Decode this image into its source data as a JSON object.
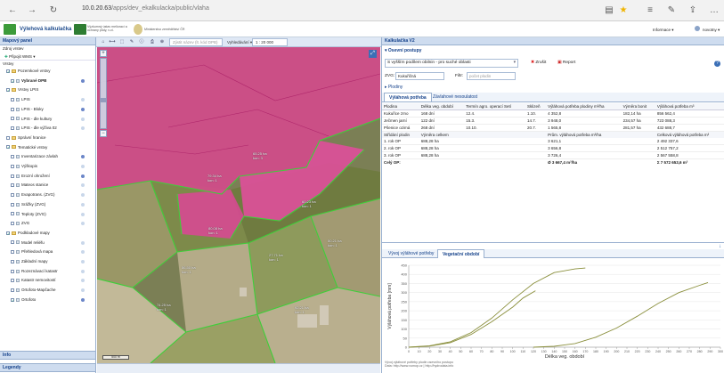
{
  "browser": {
    "url_host": "10.0.20.63",
    "url_path": "/apps/dev_ekalkulacka/public/vlaha"
  },
  "header": {
    "app_name": "Výlehová kalkulačka",
    "partner1": "Výzkumný ústav meliorací a ochrany půdy, v.v.i.",
    "partner2": "Ministerstvo zemědělství ČR",
    "menu_info": "Informace ▾",
    "menu_user": "novotny ▾"
  },
  "toolbar": {
    "search_placeholder": "Zjistit název (lt. kód DPB)",
    "search_btn": "Vyhledávání ▾",
    "scale": "1 : 20 000"
  },
  "left": {
    "title": "Mapový panel",
    "basemap_label": "Zdroj vrstev",
    "add_wms": "Připojit WMS ▾",
    "layers_root": "Vrstvy",
    "layers": [
      {
        "label": "Pozemkové vrstvy",
        "indent": 1,
        "type": "folder",
        "checked": true,
        "dot": ""
      },
      {
        "label": "Vybrané DPB",
        "indent": 2,
        "type": "layer",
        "checked": true,
        "dot": "on",
        "bold": true
      },
      {
        "label": "Vrstvy LPIS",
        "indent": 1,
        "type": "folder",
        "checked": true,
        "dot": ""
      },
      {
        "label": "LPIS",
        "indent": 2,
        "type": "layer",
        "checked": false,
        "dot": "off"
      },
      {
        "label": "LPIS - Bloky",
        "indent": 2,
        "type": "layer",
        "checked": false,
        "dot": "on"
      },
      {
        "label": "LPIS - dle kultury",
        "indent": 2,
        "type": "layer",
        "checked": false,
        "dot": "off"
      },
      {
        "label": "LPIS - dle výživa 02",
        "indent": 2,
        "type": "layer",
        "checked": false,
        "dot": "off"
      },
      {
        "label": "Správní hranice",
        "indent": 1,
        "type": "folder",
        "checked": false,
        "dot": ""
      },
      {
        "label": "Tematické vrstvy",
        "indent": 1,
        "type": "folder",
        "checked": true,
        "dot": ""
      },
      {
        "label": "Inventarizace závlah",
        "indent": 2,
        "type": "layer",
        "checked": false,
        "dot": "on"
      },
      {
        "label": "Výškopis",
        "indent": 2,
        "type": "layer",
        "checked": false,
        "dot": "off"
      },
      {
        "label": "Erozní ohrožení",
        "indent": 2,
        "type": "layer",
        "checked": false,
        "dot": "on"
      },
      {
        "label": "Mateos stanice",
        "indent": 2,
        "type": "layer",
        "checked": false,
        "dot": "off"
      },
      {
        "label": "Evapotrans. (ZVG)",
        "indent": 2,
        "type": "layer",
        "checked": false,
        "dot": "off"
      },
      {
        "label": "Srážky (ZVG)",
        "indent": 2,
        "type": "layer",
        "checked": false,
        "dot": "off"
      },
      {
        "label": "Teploty (ZVG)",
        "indent": 2,
        "type": "layer",
        "checked": false,
        "dot": "off"
      },
      {
        "label": "ZVG",
        "indent": 2,
        "type": "layer",
        "checked": false,
        "dot": "off"
      },
      {
        "label": "Podkladové mapy",
        "indent": 1,
        "type": "folder",
        "checked": true,
        "dot": ""
      },
      {
        "label": "Model reliéfu",
        "indent": 2,
        "type": "layer",
        "checked": false,
        "dot": "off"
      },
      {
        "label": "Přehledová mapa",
        "indent": 2,
        "type": "layer",
        "checked": false,
        "dot": "off"
      },
      {
        "label": "Základní mapy",
        "indent": 2,
        "type": "layer",
        "checked": false,
        "dot": "off"
      },
      {
        "label": "Rozeznávací katastr",
        "indent": 2,
        "type": "layer",
        "checked": false,
        "dot": "off"
      },
      {
        "label": "Katastr nemovitostí",
        "indent": 2,
        "type": "layer",
        "checked": false,
        "dot": "off"
      },
      {
        "label": "Ortofoto-Mapčache",
        "indent": 2,
        "type": "layer",
        "checked": false,
        "dot": "off"
      },
      {
        "label": "Ortofoto",
        "indent": 2,
        "type": "layer",
        "checked": true,
        "dot": "on"
      }
    ],
    "info": "Info",
    "legend": "Legendy"
  },
  "map": {
    "scalebar": "500 m",
    "fields": [
      {
        "l1": "65.25 ha",
        "l2": "kon: 3"
      },
      {
        "l1": "79.34 ha",
        "l2": "kon: 1"
      },
      {
        "l1": "60.23 ha",
        "l2": "kon: 1"
      },
      {
        "l1": "80.08 ha",
        "l2": "kon: 1"
      },
      {
        "l1": "50.21 ha",
        "l2": "kon: 1"
      },
      {
        "l1": "27.71 ha",
        "l2": "kon: 1"
      },
      {
        "l1": "56.50 ha",
        "l2": "kon: 1"
      },
      {
        "l1": "74.25 ha",
        "l2": "kon: 1"
      },
      {
        "l1": "92.21 ha",
        "l2": "kon: 1"
      }
    ]
  },
  "right": {
    "title": "Kalkulačka V2",
    "section_postupy": "Osevní postupy",
    "postup_select": "S vyšším podílem obilnin - pro suché oblasti",
    "btn_zrusit": "Zrušit",
    "btn_report": "Report",
    "zvg_label": "ZVG:",
    "zvg_value": "Kukuřičná",
    "filtr_label": "Filtr:",
    "filtr_placeholder": "počet plodin",
    "section_plodiny": "Plodiny",
    "tab_main": "Výláhová potřeba",
    "tab_other": "Závlahové nesoulatost",
    "table": {
      "headers": [
        "Plodina",
        "Délka veg. období",
        "Termín agro. operací Setí",
        "Sklizeň",
        "Výláhová potřeba plodiny m³/ha",
        "Výměra bonit",
        "Výláhová potřeba m³"
      ],
      "rows": [
        [
          "Kukuřice zrno",
          "168 dní",
          "12.4.",
          "1.10.",
          "4 352,8",
          "182,14 ha",
          "856 562,4"
        ],
        [
          "Ječmen jarní",
          "122 dní",
          "15.3.",
          "14.7.",
          "3 948,0",
          "234,57 ha",
          "723 088,3"
        ],
        [
          "Pšenice ozimá",
          "268 dní",
          "10.10.",
          "20.7.",
          "1 565,8",
          "281,57 ha",
          "432 688,7"
        ]
      ],
      "sub_headers": [
        "Střídání plodin",
        "Výměra celkem",
        "Prům. výláhová potřeba m³/ha",
        "Celková výláhová potřeba m³"
      ],
      "sub_rows": [
        [
          "1. rok OP",
          "688,28 ha",
          "3 621,1",
          "2 492 337,6"
        ],
        [
          "2. rok OP",
          "688,28 ha",
          "3 656,8",
          "2 512 757,2"
        ],
        [
          "3. rok OP",
          "688,28 ha",
          "3 726,4",
          "2 567 558,8"
        ]
      ],
      "total_label": "Celý OP:",
      "total_avg": "Ø 3 667,4 m³/ha",
      "total_sum": "Σ 7 572 653,6 m³"
    },
    "chart_tab1": "Vývoj výláhové potřeby",
    "chart_tab2": "Vegetační období",
    "note1": "Vývoj výláhové potřeby plodin osevního postupu",
    "note2": "Data: http://www.vumop.cz | http://hydrodata.info"
  },
  "chart_data": {
    "type": "line",
    "xlabel": "Délka veg. období",
    "ylabel": "Výláhová potřeba [mm]",
    "xlim": [
      0,
      300
    ],
    "ylim": [
      0,
      450
    ],
    "xticks": [
      0,
      10,
      20,
      30,
      40,
      50,
      60,
      70,
      80,
      90,
      100,
      110,
      120,
      130,
      140,
      150,
      160,
      170,
      180,
      190,
      200,
      210,
      220,
      230,
      240,
      250,
      260,
      270,
      280,
      290,
      300
    ],
    "yticks": [
      0,
      50,
      100,
      150,
      200,
      250,
      300,
      350,
      400,
      450
    ],
    "color": "#8a8f3c",
    "series": [
      {
        "x": [
          0,
          20,
          40,
          60,
          80,
          100,
          120,
          140,
          160,
          170
        ],
        "y": [
          0,
          8,
          30,
          80,
          160,
          260,
          350,
          410,
          430,
          435
        ]
      },
      {
        "x": [
          0,
          20,
          40,
          60,
          80,
          100,
          110,
          122
        ],
        "y": [
          0,
          6,
          25,
          70,
          140,
          220,
          270,
          310
        ]
      },
      {
        "x": [
          120,
          140,
          160,
          180,
          200,
          220,
          240,
          260,
          280,
          288
        ],
        "y": [
          0,
          5,
          20,
          55,
          105,
          170,
          240,
          300,
          340,
          355
        ]
      }
    ]
  }
}
